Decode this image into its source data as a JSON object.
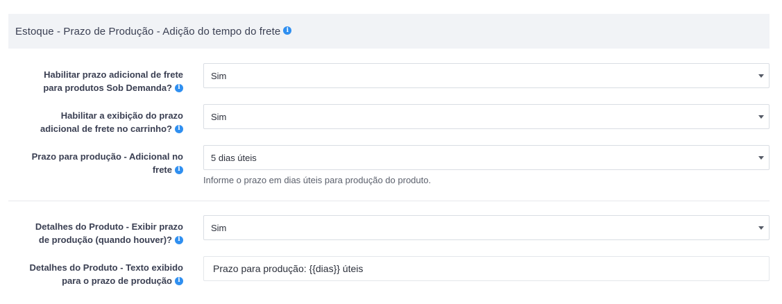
{
  "section": {
    "title": "Estoque - Prazo de Produção - Adição do tempo do frete"
  },
  "fields": [
    {
      "label_line1": "Habilitar prazo adicional de frete",
      "label_line2": "para produtos Sob Demanda?",
      "value": "Sim"
    },
    {
      "label_line1": "Habilitar a exibição do prazo",
      "label_line2": "adicional de frete no carrinho?",
      "value": "Sim"
    },
    {
      "label_line1": "Prazo para produção - Adicional no",
      "label_line2": "frete",
      "value": "5 dias úteis",
      "help": "Informe o prazo em dias úteis para produção do produto."
    },
    {
      "label_line1": "Detalhes do Produto - Exibir prazo",
      "label_line2": "de produção (quando houver)?",
      "value": "Sim"
    },
    {
      "label_line1": "Detalhes do Produto - Texto exibido",
      "label_line2": "para o prazo de produção",
      "value": "Prazo para produção: {{dias}} úteis"
    }
  ],
  "icons": {
    "info": "info-icon",
    "info_color": "#2f8ff0",
    "dropdown": "chevron-down-icon"
  }
}
